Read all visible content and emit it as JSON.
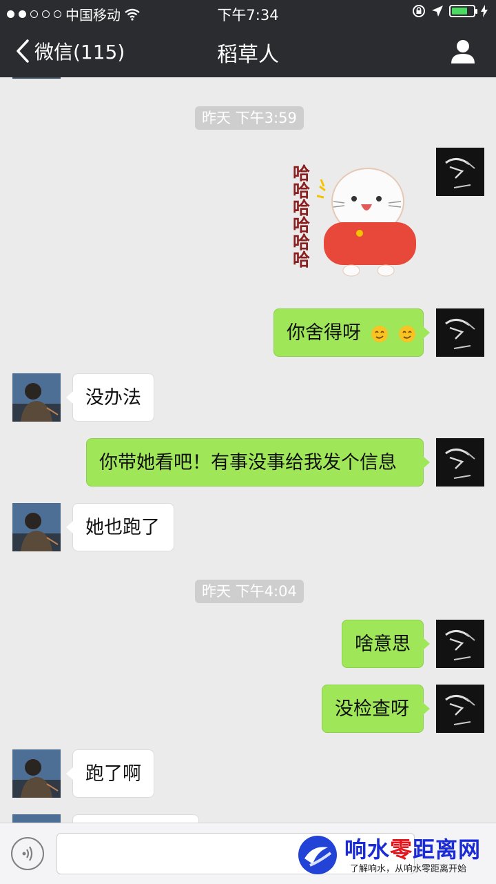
{
  "status_bar": {
    "carrier": "中国移动",
    "time": "下午7:34"
  },
  "nav": {
    "back_label": "微信(115)",
    "title": "稻草人"
  },
  "timestamps": [
    "昨天 下午3:59",
    "昨天 下午4:04"
  ],
  "messages": [
    {
      "sender": "me",
      "type": "sticker",
      "sticker_text": "哈哈哈哈哈哈"
    },
    {
      "sender": "me",
      "type": "text",
      "text": "你舍得呀"
    },
    {
      "sender": "other",
      "type": "text",
      "text": "没办法"
    },
    {
      "sender": "me",
      "type": "text",
      "text": "你带她看吧！有事没事给我发个信息"
    },
    {
      "sender": "other",
      "type": "text",
      "text": "她也跑了"
    },
    {
      "sender": "me",
      "type": "text",
      "text": "啥意思"
    },
    {
      "sender": "me",
      "type": "text",
      "text": "没检查呀"
    },
    {
      "sender": "other",
      "type": "text",
      "text": "跑了啊"
    }
  ],
  "watermark": {
    "title_blue_1": "响水",
    "title_red": "零",
    "title_blue_2": "距离网",
    "subtitle": "了解响水，从响水零距离开始"
  },
  "colors": {
    "header": "#2b2c30",
    "bubble_me": "#9fe658",
    "bubble_other": "#ffffff",
    "background": "#ebebeb"
  }
}
